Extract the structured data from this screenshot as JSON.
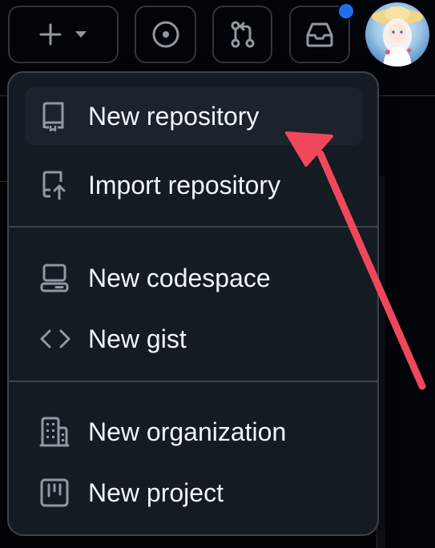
{
  "header": {
    "create_icon": "plus-icon",
    "create_caret_icon": "triangle-down-icon",
    "issues_icon": "issue-opened-icon",
    "pulls_icon": "git-pull-request-icon",
    "inbox_icon": "inbox-icon",
    "notification_color": "#1f6feb",
    "avatar_icon": "user-avatar"
  },
  "menu": {
    "items": [
      {
        "label": "New repository",
        "icon": "repo-icon",
        "highlighted": true
      },
      {
        "label": "Import repository",
        "icon": "repo-push-icon"
      },
      {
        "label": "New codespace",
        "icon": "codespaces-icon"
      },
      {
        "label": "New gist",
        "icon": "code-icon"
      },
      {
        "label": "New organization",
        "icon": "organization-icon"
      },
      {
        "label": "New project",
        "icon": "project-icon"
      }
    ]
  },
  "annotation": {
    "arrow_color": "#f0485a"
  },
  "colors": {
    "background": "#010409",
    "menu_background": "#151b23",
    "border": "#3d444d",
    "text": "#f0f6fc",
    "icon": "#9198a1"
  }
}
